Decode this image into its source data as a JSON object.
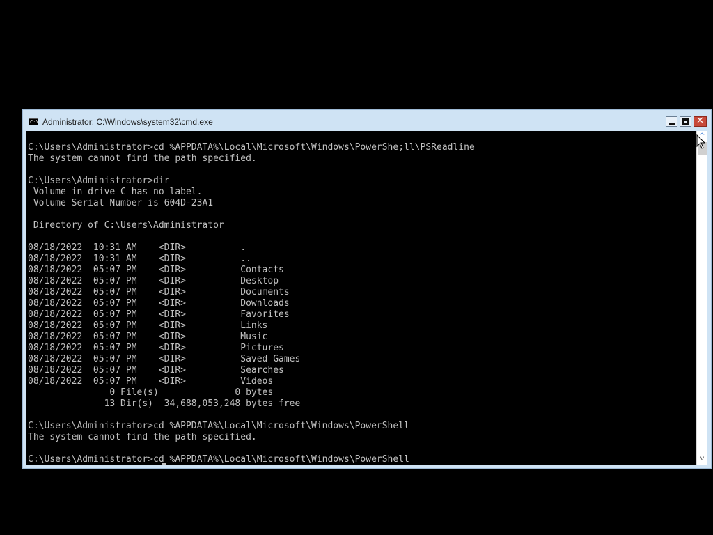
{
  "window": {
    "title": "Administrator: C:\\Windows\\system32\\cmd.exe",
    "icon_glyph": "C:\\",
    "icon": "cmd-icon",
    "controls": {
      "minimize": "minimize-icon",
      "maximize": "maximize-icon",
      "close": "✕"
    },
    "colors": {
      "frame": "#cfe3f4",
      "console_background": "#000000",
      "console_text": "#c0c0c0",
      "close_button": "#c7493a"
    }
  },
  "console": {
    "lines": [
      "C:\\Users\\Administrator>cd %APPDATA%\\Local\\Microsoft\\Windows\\PowerShe;ll\\PSReadline",
      "The system cannot find the path specified.",
      "",
      "C:\\Users\\Administrator>dir",
      " Volume in drive C has no label.",
      " Volume Serial Number is 604D-23A1",
      "",
      " Directory of C:\\Users\\Administrator",
      "",
      "08/18/2022  10:31 AM    <DIR>          .",
      "08/18/2022  10:31 AM    <DIR>          ..",
      "08/18/2022  05:07 PM    <DIR>          Contacts",
      "08/18/2022  05:07 PM    <DIR>          Desktop",
      "08/18/2022  05:07 PM    <DIR>          Documents",
      "08/18/2022  05:07 PM    <DIR>          Downloads",
      "08/18/2022  05:07 PM    <DIR>          Favorites",
      "08/18/2022  05:07 PM    <DIR>          Links",
      "08/18/2022  05:07 PM    <DIR>          Music",
      "08/18/2022  05:07 PM    <DIR>          Pictures",
      "08/18/2022  05:07 PM    <DIR>          Saved Games",
      "08/18/2022  05:07 PM    <DIR>          Searches",
      "08/18/2022  05:07 PM    <DIR>          Videos",
      "               0 File(s)              0 bytes",
      "              13 Dir(s)  34,688,053,248 bytes free",
      "",
      "C:\\Users\\Administrator>cd %APPDATA%\\Local\\Microsoft\\Windows\\PowerShell",
      "The system cannot find the path specified.",
      "",
      "C:\\Users\\Administrator>cd %APPDATA%\\Local\\Microsoft\\Windows\\PowerShell"
    ]
  },
  "scrollbar": {
    "up_arrow": "^",
    "down_arrow": "v"
  }
}
